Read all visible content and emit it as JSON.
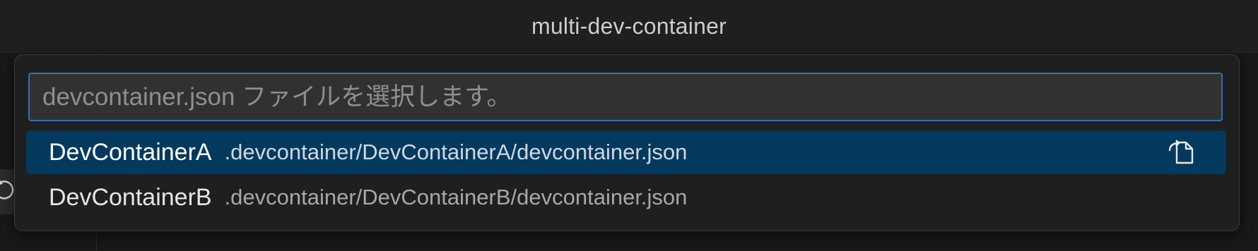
{
  "window": {
    "title": "multi-dev-container"
  },
  "quick_pick": {
    "input": {
      "placeholder": "devcontainer.json ファイルを選択します。",
      "value": ""
    },
    "items": [
      {
        "label": "DevContainerA",
        "description": ".devcontainer/DevContainerA/devcontainer.json",
        "selected": true,
        "action_icon": "open-file-icon"
      },
      {
        "label": "DevContainerB",
        "description": ".devcontainer/DevContainerB/devcontainer.json",
        "selected": false
      }
    ]
  },
  "colors": {
    "accent": "#2f6fbf",
    "selection": "#04395e",
    "background": "#181818"
  },
  "icons": {
    "side_button": "history-icon"
  }
}
